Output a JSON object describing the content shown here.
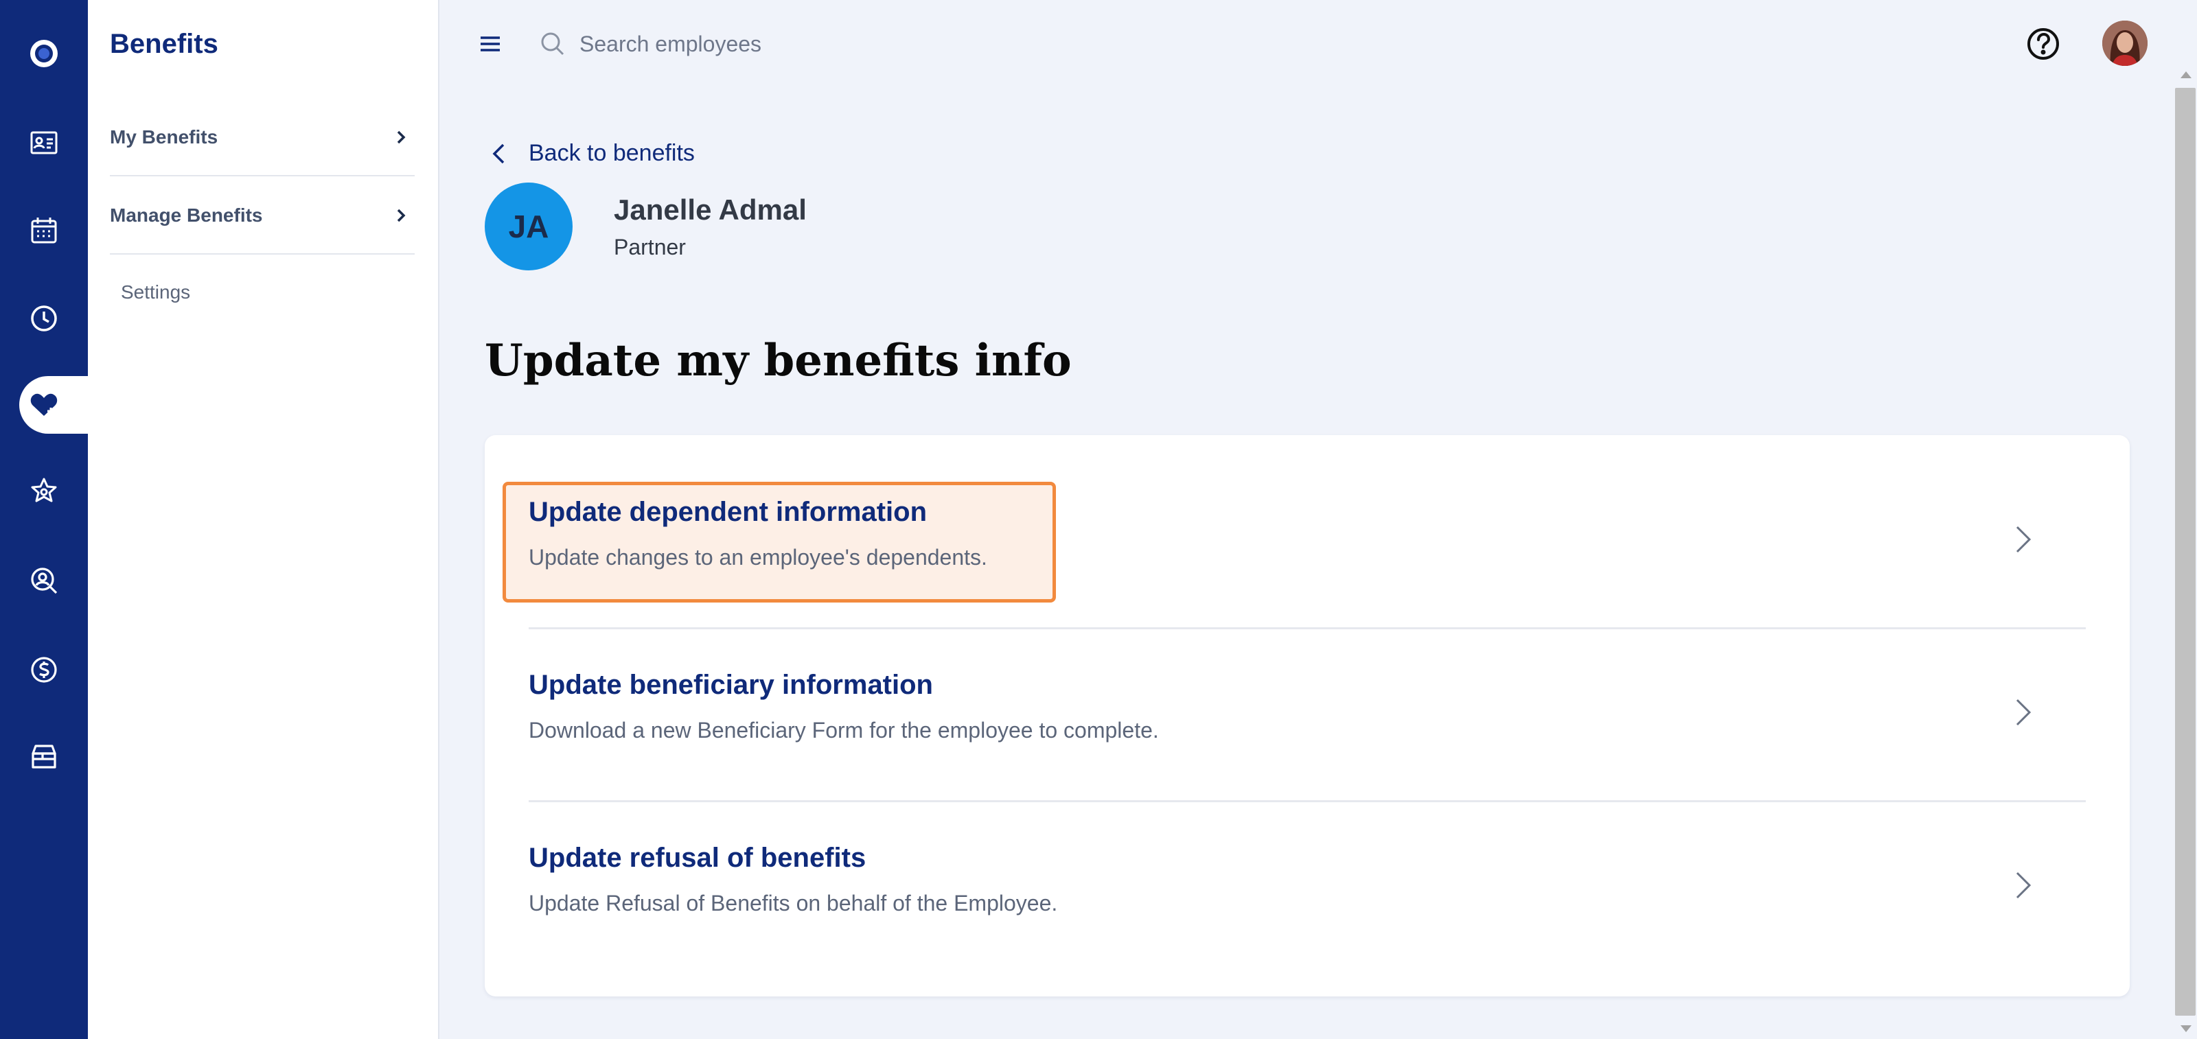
{
  "app": {
    "section_title": "Benefits"
  },
  "rail": {
    "items": [
      {
        "icon": "logo-icon"
      },
      {
        "icon": "id-card-icon"
      },
      {
        "icon": "calendar-icon"
      },
      {
        "icon": "clock-icon"
      },
      {
        "icon": "heart-plus-icon",
        "active": true
      },
      {
        "icon": "star-icon"
      },
      {
        "icon": "person-search-icon"
      },
      {
        "icon": "dollar-circle-icon"
      },
      {
        "icon": "store-icon"
      }
    ]
  },
  "subnav": {
    "items": [
      {
        "label": "My Benefits"
      },
      {
        "label": "Manage Benefits"
      }
    ],
    "settings_label": "Settings"
  },
  "topbar": {
    "search_placeholder": "Search employees"
  },
  "main": {
    "back_label": "Back to benefits",
    "employee": {
      "initials": "JA",
      "name": "Janelle Admal",
      "role": "Partner"
    },
    "page_title": "Update my benefits info",
    "options": [
      {
        "title": "Update dependent information",
        "description": "Update changes to an employee's dependents.",
        "highlighted": true
      },
      {
        "title": "Update beneficiary information",
        "description": "Download a new Beneficiary Form for the employee to complete."
      },
      {
        "title": "Update refusal of benefits",
        "description": "Update Refusal of Benefits on behalf of the Employee."
      }
    ]
  },
  "colors": {
    "rail_background": "#0f2a7a",
    "accent_navy": "#0f2a7a",
    "avatar_blue": "#1495e6",
    "highlight_border": "#f28a3e",
    "highlight_fill": "#fdefe6",
    "page_background": "#f0f3fa"
  }
}
